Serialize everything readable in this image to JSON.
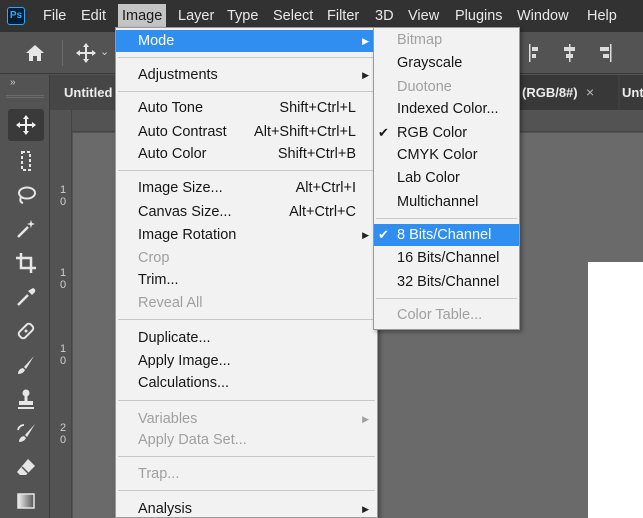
{
  "app": {
    "logo_text": "Ps"
  },
  "menubar": {
    "items": [
      "File",
      "Edit",
      "Image",
      "Layer",
      "Type",
      "Select",
      "Filter",
      "3D",
      "View",
      "Plugins",
      "Window",
      "Help"
    ]
  },
  "tabs": {
    "tab1": "Untitled",
    "tab2": "(RGB/8#)",
    "tab2_close": "×",
    "tab3": "Unt"
  },
  "rulers": {
    "vertical_marks": [
      "1",
      "0",
      "1",
      "0",
      "1",
      "0",
      "2",
      "0"
    ]
  },
  "image_menu": {
    "mode": {
      "label": "Mode"
    },
    "adjustments": {
      "label": "Adjustments"
    },
    "auto_tone": {
      "label": "Auto Tone",
      "shortcut": "Shift+Ctrl+L"
    },
    "auto_contrast": {
      "label": "Auto Contrast",
      "shortcut": "Alt+Shift+Ctrl+L"
    },
    "auto_color": {
      "label": "Auto Color",
      "shortcut": "Shift+Ctrl+B"
    },
    "image_size": {
      "label": "Image Size...",
      "shortcut": "Alt+Ctrl+I"
    },
    "canvas_size": {
      "label": "Canvas Size...",
      "shortcut": "Alt+Ctrl+C"
    },
    "image_rotation": {
      "label": "Image Rotation"
    },
    "crop": {
      "label": "Crop"
    },
    "trim": {
      "label": "Trim..."
    },
    "reveal_all": {
      "label": "Reveal All"
    },
    "duplicate": {
      "label": "Duplicate..."
    },
    "apply_image": {
      "label": "Apply Image..."
    },
    "calculations": {
      "label": "Calculations..."
    },
    "variables": {
      "label": "Variables"
    },
    "apply_data_set": {
      "label": "Apply Data Set..."
    },
    "trap": {
      "label": "Trap..."
    },
    "analysis": {
      "label": "Analysis"
    }
  },
  "mode_submenu": {
    "bitmap": "Bitmap",
    "grayscale": "Grayscale",
    "duotone": "Duotone",
    "indexed_color": "Indexed Color...",
    "rgb_color": "RGB Color",
    "cmyk_color": "CMYK Color",
    "lab_color": "Lab Color",
    "multichannel": "Multichannel",
    "bits_8": "8 Bits/Channel",
    "bits_16": "16 Bits/Channel",
    "bits_32": "32 Bits/Channel",
    "color_table": "Color Table...",
    "checked_mark": "✔"
  },
  "colors": {
    "highlight": "#2f8ef0",
    "menubar_bg": "#323232",
    "menu_bg": "#f2f2f2",
    "canvas_bg": "#6a6a6a"
  }
}
